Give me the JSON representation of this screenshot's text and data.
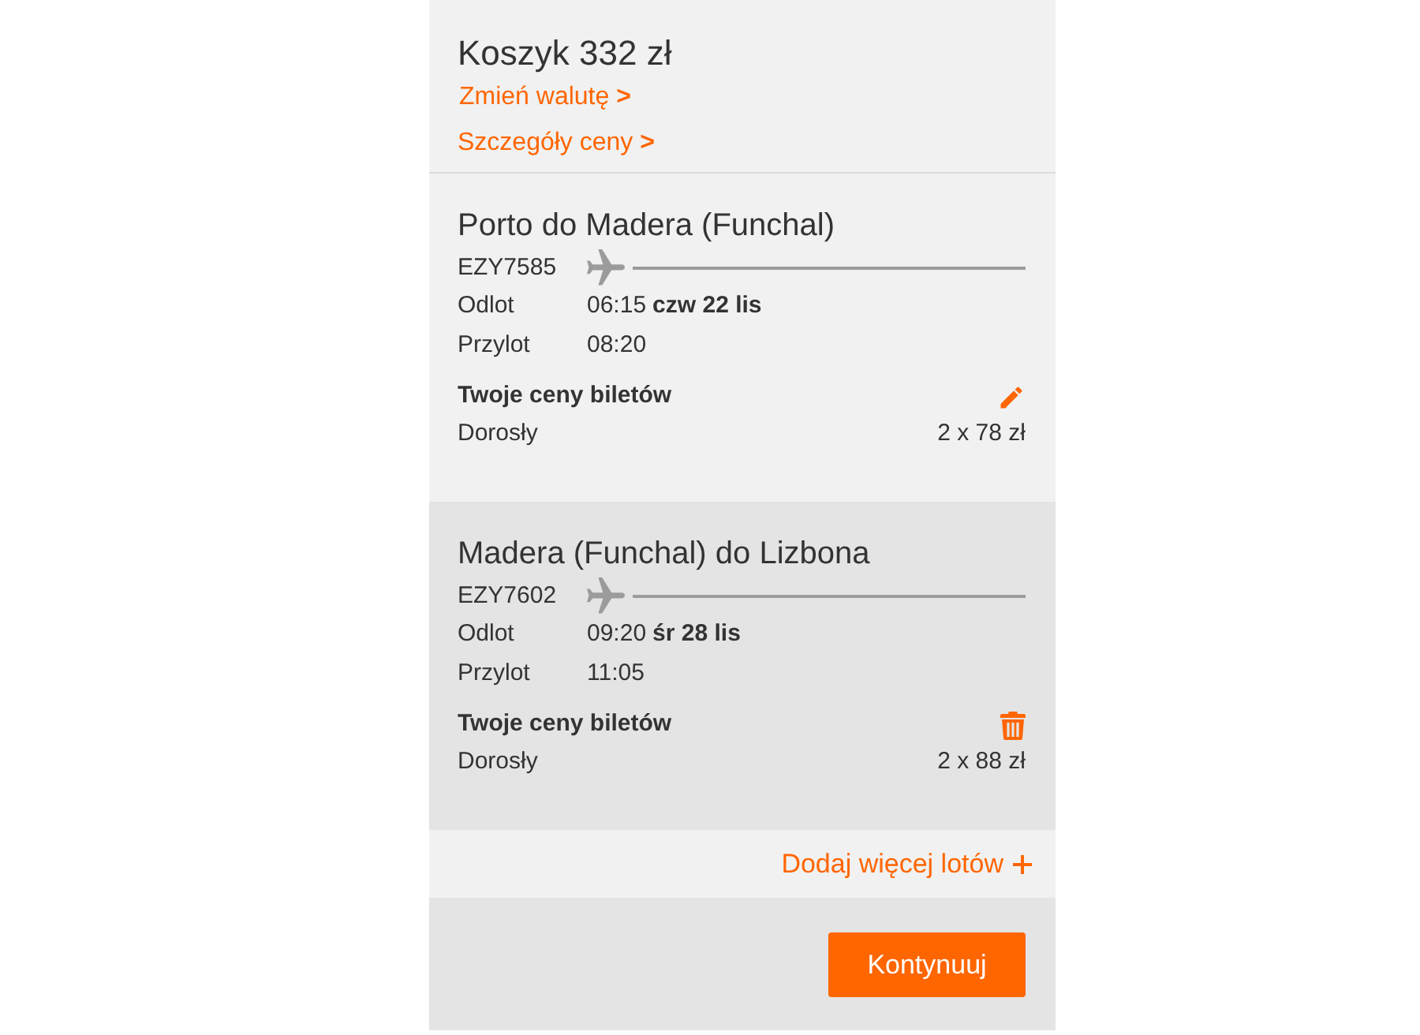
{
  "cart": {
    "title": "Koszyk 332 zł",
    "links": [
      "Zmień walutę **>**",
      "Szczegóły ceny **>**"
    ]
  },
  "flights": [
    {
      "route": "Porto do Madera (Funchal)",
      "flight_number": "EZY7585",
      "times": [
        {
          "label": "Odlot",
          "time": "06:15",
          "date": "czw 22 lis"
        },
        {
          "label": "Przylot",
          "time": "08:20"
        }
      ],
      "prices_heading": "Twoje ceny biletów",
      "kind": "editable",
      "fares": [
        {
          "passenger": "Dorosły",
          "price": "2 x 78 zł"
        }
      ]
    },
    {
      "route": "Madera (Funchal) do Lizbona",
      "flight_number": "EZY7602",
      "times": [
        {
          "label": "Odlot",
          "time": "09:20",
          "date": "śr 28 lis"
        },
        {
          "label": "Przylot",
          "time": "11:05"
        }
      ],
      "prices_heading": "Twoje ceny biletów",
      "kind": "removable",
      "fares": [
        {
          "passenger": "Dorosły",
          "price": "2 x 88 zł"
        }
      ]
    }
  ],
  "add_flights": {
    "label": "Dodaj więcej lotów"
  },
  "continue_button": "Kontynuuj"
}
